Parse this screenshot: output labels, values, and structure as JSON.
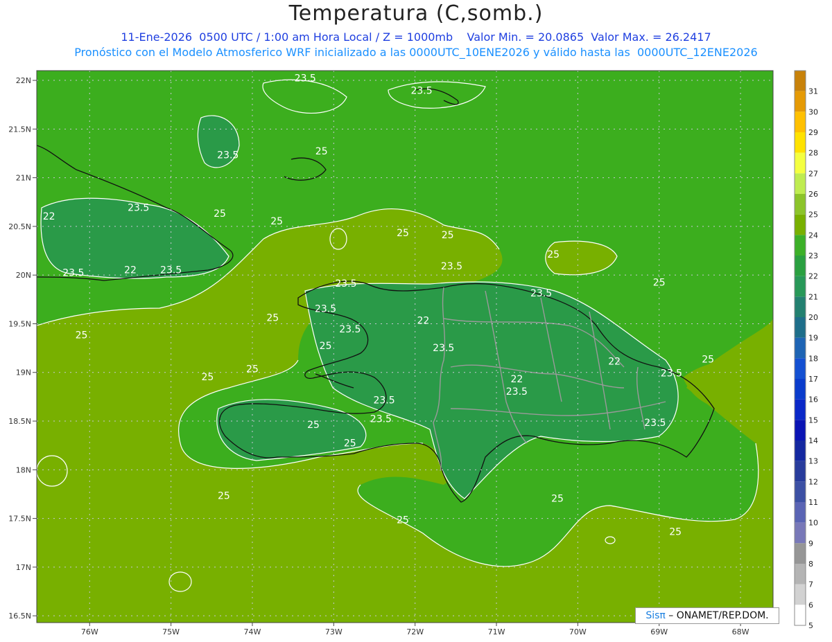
{
  "header": {
    "title": "Temperatura (C,somb.)",
    "subtitle_line1": "11-Ene-2026  0500 UTC / 1:00 am Hora Local / Z = 1000mb    Valor Min. = 20.0865  Valor Max. = 26.2417",
    "subtitle_line2": "Pronóstico con el Modelo Atmosferico WRF inicializado a las 0000UTC_10ENE2026 y válido hasta las  0000UTC_12ENE2026"
  },
  "axes": {
    "lat_labels": [
      "22N",
      "21.5N",
      "21N",
      "20.5N",
      "20N",
      "19.5N",
      "19N",
      "18.5N",
      "18N",
      "17.5N",
      "17N",
      "16.5N"
    ],
    "lat_values": [
      22,
      21.5,
      21,
      20.5,
      20,
      19.5,
      19,
      18.5,
      18,
      17.5,
      17,
      16.5
    ],
    "lon_labels": [
      "76W",
      "75W",
      "74W",
      "73W",
      "72W",
      "71W",
      "70W",
      "69W",
      "68W"
    ],
    "lon_values": [
      -76,
      -75,
      -74,
      -73,
      -72,
      -71,
      -70,
      -69,
      -68
    ]
  },
  "colorbar": {
    "labels": [
      "31",
      "30",
      "29",
      "28",
      "27",
      "26",
      "25",
      "24",
      "23",
      "22",
      "21",
      "20",
      "19",
      "18",
      "17",
      "16",
      "15",
      "14",
      "13",
      "12",
      "11",
      "10",
      "9",
      "8",
      "7",
      "6",
      "5"
    ],
    "colors": [
      "#c8820a",
      "#e59a05",
      "#ffc000",
      "#ffe200",
      "#f4ff40",
      "#bfec50",
      "#8cc42a",
      "#78b000",
      "#3cb028",
      "#2aa040",
      "#289858",
      "#238070",
      "#1e6e8a",
      "#1e64b4",
      "#1450d2",
      "#0a3ccc",
      "#0a28c8",
      "#0a14b4",
      "#1428a0",
      "#283c9c",
      "#3c50a4",
      "#5a64b4",
      "#7878b8",
      "#969696",
      "#b4b4b4",
      "#d2d2d2",
      "#ffffff"
    ]
  },
  "contour_labels": [
    {
      "text": "23.5",
      "lon": -73.35,
      "lat": 21.99
    },
    {
      "text": "23.5",
      "lon": -71.92,
      "lat": 21.86
    },
    {
      "text": "25",
      "lon": -73.15,
      "lat": 21.24
    },
    {
      "text": "23.5",
      "lon": -74.3,
      "lat": 21.2
    },
    {
      "text": "23.5",
      "lon": -75.4,
      "lat": 20.66
    },
    {
      "text": "25",
      "lon": -74.4,
      "lat": 20.6
    },
    {
      "text": "25",
      "lon": -73.7,
      "lat": 20.52
    },
    {
      "text": "22",
      "lon": -76.5,
      "lat": 20.57
    },
    {
      "text": "25",
      "lon": -72.15,
      "lat": 20.4
    },
    {
      "text": "25",
      "lon": -71.6,
      "lat": 20.38
    },
    {
      "text": "23.5",
      "lon": -71.55,
      "lat": 20.06
    },
    {
      "text": "25",
      "lon": -70.3,
      "lat": 20.18
    },
    {
      "text": "23.5",
      "lon": -76.2,
      "lat": 19.99
    },
    {
      "text": "22",
      "lon": -75.5,
      "lat": 20.02
    },
    {
      "text": "23.5",
      "lon": -75.0,
      "lat": 20.02
    },
    {
      "text": "23.5",
      "lon": -72.85,
      "lat": 19.88
    },
    {
      "text": "25",
      "lon": -69.0,
      "lat": 19.89
    },
    {
      "text": "23.5",
      "lon": -70.45,
      "lat": 19.78
    },
    {
      "text": "23.5",
      "lon": -73.1,
      "lat": 19.62
    },
    {
      "text": "25",
      "lon": -73.75,
      "lat": 19.53
    },
    {
      "text": "22",
      "lon": -71.9,
      "lat": 19.5
    },
    {
      "text": "25",
      "lon": -76.1,
      "lat": 19.35
    },
    {
      "text": "23.5",
      "lon": -72.8,
      "lat": 19.41
    },
    {
      "text": "25",
      "lon": -73.1,
      "lat": 19.24
    },
    {
      "text": "23.5",
      "lon": -71.65,
      "lat": 19.22
    },
    {
      "text": "22",
      "lon": -69.55,
      "lat": 19.08
    },
    {
      "text": "25",
      "lon": -68.4,
      "lat": 19.1
    },
    {
      "text": "23.5",
      "lon": -68.85,
      "lat": 18.96
    },
    {
      "text": "25",
      "lon": -74.0,
      "lat": 19.0
    },
    {
      "text": "25",
      "lon": -74.55,
      "lat": 18.92
    },
    {
      "text": "22",
      "lon": -70.75,
      "lat": 18.9
    },
    {
      "text": "23.5",
      "lon": -70.75,
      "lat": 18.77
    },
    {
      "text": "23.5",
      "lon": -72.38,
      "lat": 18.68
    },
    {
      "text": "23.5",
      "lon": -72.42,
      "lat": 18.49
    },
    {
      "text": "23.5",
      "lon": -69.05,
      "lat": 18.45
    },
    {
      "text": "25",
      "lon": -73.25,
      "lat": 18.43
    },
    {
      "text": "25",
      "lon": -72.8,
      "lat": 18.24
    },
    {
      "text": "25",
      "lon": -74.35,
      "lat": 17.7
    },
    {
      "text": "25",
      "lon": -70.25,
      "lat": 17.67
    },
    {
      "text": "25",
      "lon": -72.15,
      "lat": 17.45
    },
    {
      "text": "25",
      "lon": -68.8,
      "lat": 17.33
    }
  ],
  "credit": {
    "brand": "Sisπ",
    "text": " – ONAMET/REP.DOM."
  }
}
